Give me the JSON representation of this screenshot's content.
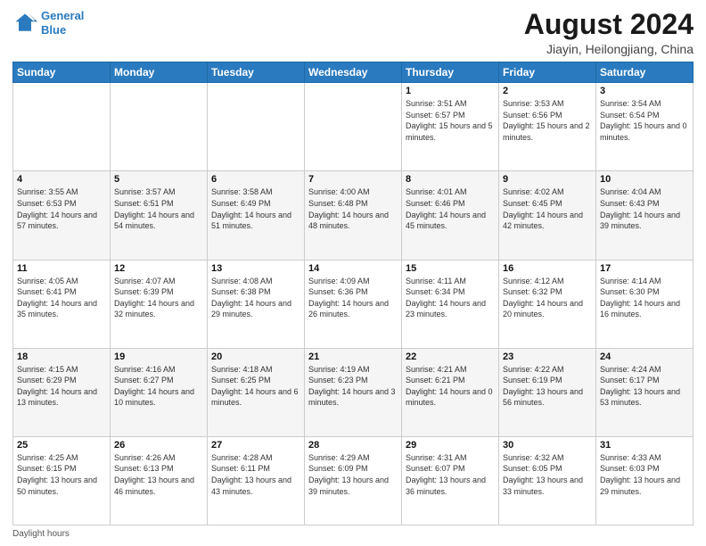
{
  "header": {
    "logo_line1": "General",
    "logo_line2": "Blue",
    "title": "August 2024",
    "subtitle": "Jiayin, Heilongjiang, China"
  },
  "days_of_week": [
    "Sunday",
    "Monday",
    "Tuesday",
    "Wednesday",
    "Thursday",
    "Friday",
    "Saturday"
  ],
  "weeks": [
    [
      {
        "day": "",
        "info": ""
      },
      {
        "day": "",
        "info": ""
      },
      {
        "day": "",
        "info": ""
      },
      {
        "day": "",
        "info": ""
      },
      {
        "day": "1",
        "info": "Sunrise: 3:51 AM\nSunset: 6:57 PM\nDaylight: 15 hours\nand 5 minutes."
      },
      {
        "day": "2",
        "info": "Sunrise: 3:53 AM\nSunset: 6:56 PM\nDaylight: 15 hours\nand 2 minutes."
      },
      {
        "day": "3",
        "info": "Sunrise: 3:54 AM\nSunset: 6:54 PM\nDaylight: 15 hours\nand 0 minutes."
      }
    ],
    [
      {
        "day": "4",
        "info": "Sunrise: 3:55 AM\nSunset: 6:53 PM\nDaylight: 14 hours\nand 57 minutes."
      },
      {
        "day": "5",
        "info": "Sunrise: 3:57 AM\nSunset: 6:51 PM\nDaylight: 14 hours\nand 54 minutes."
      },
      {
        "day": "6",
        "info": "Sunrise: 3:58 AM\nSunset: 6:49 PM\nDaylight: 14 hours\nand 51 minutes."
      },
      {
        "day": "7",
        "info": "Sunrise: 4:00 AM\nSunset: 6:48 PM\nDaylight: 14 hours\nand 48 minutes."
      },
      {
        "day": "8",
        "info": "Sunrise: 4:01 AM\nSunset: 6:46 PM\nDaylight: 14 hours\nand 45 minutes."
      },
      {
        "day": "9",
        "info": "Sunrise: 4:02 AM\nSunset: 6:45 PM\nDaylight: 14 hours\nand 42 minutes."
      },
      {
        "day": "10",
        "info": "Sunrise: 4:04 AM\nSunset: 6:43 PM\nDaylight: 14 hours\nand 39 minutes."
      }
    ],
    [
      {
        "day": "11",
        "info": "Sunrise: 4:05 AM\nSunset: 6:41 PM\nDaylight: 14 hours\nand 35 minutes."
      },
      {
        "day": "12",
        "info": "Sunrise: 4:07 AM\nSunset: 6:39 PM\nDaylight: 14 hours\nand 32 minutes."
      },
      {
        "day": "13",
        "info": "Sunrise: 4:08 AM\nSunset: 6:38 PM\nDaylight: 14 hours\nand 29 minutes."
      },
      {
        "day": "14",
        "info": "Sunrise: 4:09 AM\nSunset: 6:36 PM\nDaylight: 14 hours\nand 26 minutes."
      },
      {
        "day": "15",
        "info": "Sunrise: 4:11 AM\nSunset: 6:34 PM\nDaylight: 14 hours\nand 23 minutes."
      },
      {
        "day": "16",
        "info": "Sunrise: 4:12 AM\nSunset: 6:32 PM\nDaylight: 14 hours\nand 20 minutes."
      },
      {
        "day": "17",
        "info": "Sunrise: 4:14 AM\nSunset: 6:30 PM\nDaylight: 14 hours\nand 16 minutes."
      }
    ],
    [
      {
        "day": "18",
        "info": "Sunrise: 4:15 AM\nSunset: 6:29 PM\nDaylight: 14 hours\nand 13 minutes."
      },
      {
        "day": "19",
        "info": "Sunrise: 4:16 AM\nSunset: 6:27 PM\nDaylight: 14 hours\nand 10 minutes."
      },
      {
        "day": "20",
        "info": "Sunrise: 4:18 AM\nSunset: 6:25 PM\nDaylight: 14 hours\nand 6 minutes."
      },
      {
        "day": "21",
        "info": "Sunrise: 4:19 AM\nSunset: 6:23 PM\nDaylight: 14 hours\nand 3 minutes."
      },
      {
        "day": "22",
        "info": "Sunrise: 4:21 AM\nSunset: 6:21 PM\nDaylight: 14 hours\nand 0 minutes."
      },
      {
        "day": "23",
        "info": "Sunrise: 4:22 AM\nSunset: 6:19 PM\nDaylight: 13 hours\nand 56 minutes."
      },
      {
        "day": "24",
        "info": "Sunrise: 4:24 AM\nSunset: 6:17 PM\nDaylight: 13 hours\nand 53 minutes."
      }
    ],
    [
      {
        "day": "25",
        "info": "Sunrise: 4:25 AM\nSunset: 6:15 PM\nDaylight: 13 hours\nand 50 minutes."
      },
      {
        "day": "26",
        "info": "Sunrise: 4:26 AM\nSunset: 6:13 PM\nDaylight: 13 hours\nand 46 minutes."
      },
      {
        "day": "27",
        "info": "Sunrise: 4:28 AM\nSunset: 6:11 PM\nDaylight: 13 hours\nand 43 minutes."
      },
      {
        "day": "28",
        "info": "Sunrise: 4:29 AM\nSunset: 6:09 PM\nDaylight: 13 hours\nand 39 minutes."
      },
      {
        "day": "29",
        "info": "Sunrise: 4:31 AM\nSunset: 6:07 PM\nDaylight: 13 hours\nand 36 minutes."
      },
      {
        "day": "30",
        "info": "Sunrise: 4:32 AM\nSunset: 6:05 PM\nDaylight: 13 hours\nand 33 minutes."
      },
      {
        "day": "31",
        "info": "Sunrise: 4:33 AM\nSunset: 6:03 PM\nDaylight: 13 hours\nand 29 minutes."
      }
    ]
  ],
  "footer": {
    "note": "Daylight hours"
  }
}
